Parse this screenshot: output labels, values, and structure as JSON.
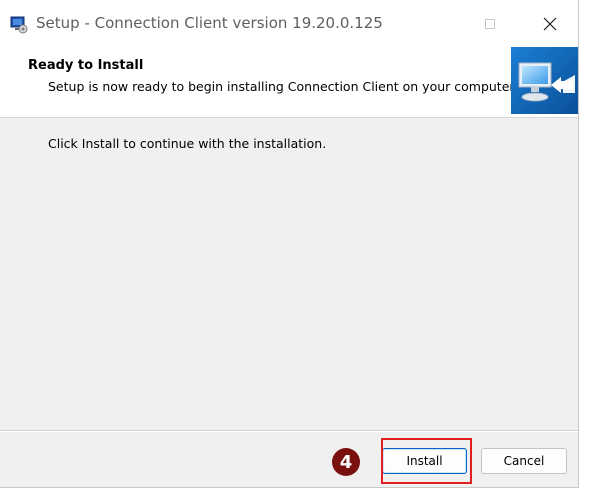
{
  "window": {
    "title": "Setup - Connection Client version 19.20.0.125",
    "controls": {
      "minimize_glyph": "—",
      "maximize_glyph": "☐",
      "close_glyph": "✕"
    }
  },
  "header": {
    "title": "Ready to Install",
    "subtitle": "Setup is now ready to begin installing Connection Client on your computer.",
    "graphic_icon": "computer-arrow-icon"
  },
  "body": {
    "message": "Click Install to continue with the installation."
  },
  "buttons": {
    "install_label": "Install",
    "cancel_label": "Cancel"
  },
  "annotation": {
    "step_number": "4",
    "highlight_color": "#e02020",
    "badge_color": "#7a1010"
  },
  "colors": {
    "accent": "#0067c0",
    "dialog_background": "#f0f0f0"
  }
}
